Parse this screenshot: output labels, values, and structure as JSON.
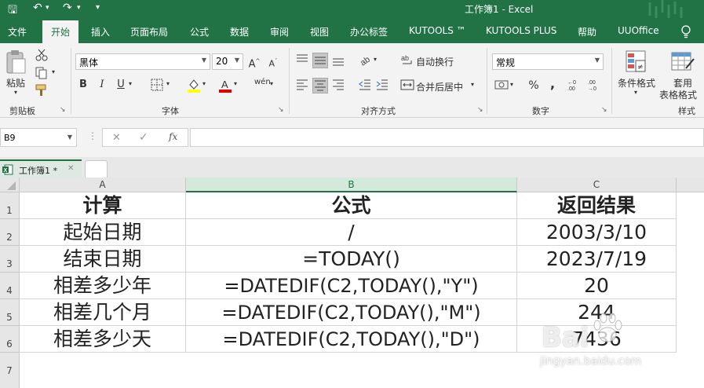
{
  "title": {
    "text": "工作簿1  -  Excel"
  },
  "quick_access": {
    "save": "🖫",
    "undo": "↶",
    "redo": "↷",
    "customize": "▾"
  },
  "menu": {
    "items": [
      "文件",
      "开始",
      "插入",
      "页面布局",
      "公式",
      "数据",
      "审阅",
      "视图",
      "办公标签",
      "KUTOOLS ™",
      "KUTOOLS PLUS",
      "帮助",
      "UUOffice"
    ]
  },
  "ribbon": {
    "clipboard": {
      "label": "剪贴板",
      "paste": "粘贴"
    },
    "font": {
      "label": "字体",
      "name": "黑体",
      "size": "20",
      "bold": "B",
      "italic": "I",
      "underline": "U",
      "grow": "A",
      "shrink": "A",
      "phonetic": "wén"
    },
    "alignment": {
      "label": "对齐方式",
      "wrap": "自动换行",
      "merge": "合并后居中"
    },
    "number": {
      "label": "数字",
      "format": "常规",
      "percent": "%",
      "comma": ","
    },
    "styles": {
      "label": "样式",
      "conditional": "条件格式",
      "table": "套用",
      "table2": "表格格式"
    }
  },
  "formula_bar": {
    "name_box": "B9",
    "cancel": "✕",
    "enter": "✓",
    "fx": "fx",
    "value": ""
  },
  "workbook_tab": {
    "name": "工作簿1 *",
    "close": "✕"
  },
  "sheet": {
    "columns": [
      "A",
      "B",
      "C"
    ],
    "selected_column": "B",
    "rows": [
      "1",
      "2",
      "3",
      "4",
      "5",
      "6",
      "7"
    ],
    "cells": [
      [
        "计算",
        "公式",
        "返回结果"
      ],
      [
        "起始日期",
        "/",
        "2003/3/10"
      ],
      [
        "结束日期",
        "=TODAY()",
        "2023/7/19"
      ],
      [
        "相差多少年",
        "=DATEDIF(C2,TODAY(),\"Y\")",
        "20"
      ],
      [
        "相差几个月",
        "=DATEDIF(C2,TODAY(),\"M\")",
        "244"
      ],
      [
        "相差多少天",
        "=DATEDIF(C2,TODAY(),\"D\")",
        "7436"
      ]
    ]
  },
  "watermark": {
    "brand": "Bai",
    "url": "jingyan.baidu.com"
  },
  "colors": {
    "accent": "#217346",
    "ribbon_bg": "#f3f3f3",
    "header_bg": "#e6e6e6",
    "selected_header": "#d2e9db"
  }
}
